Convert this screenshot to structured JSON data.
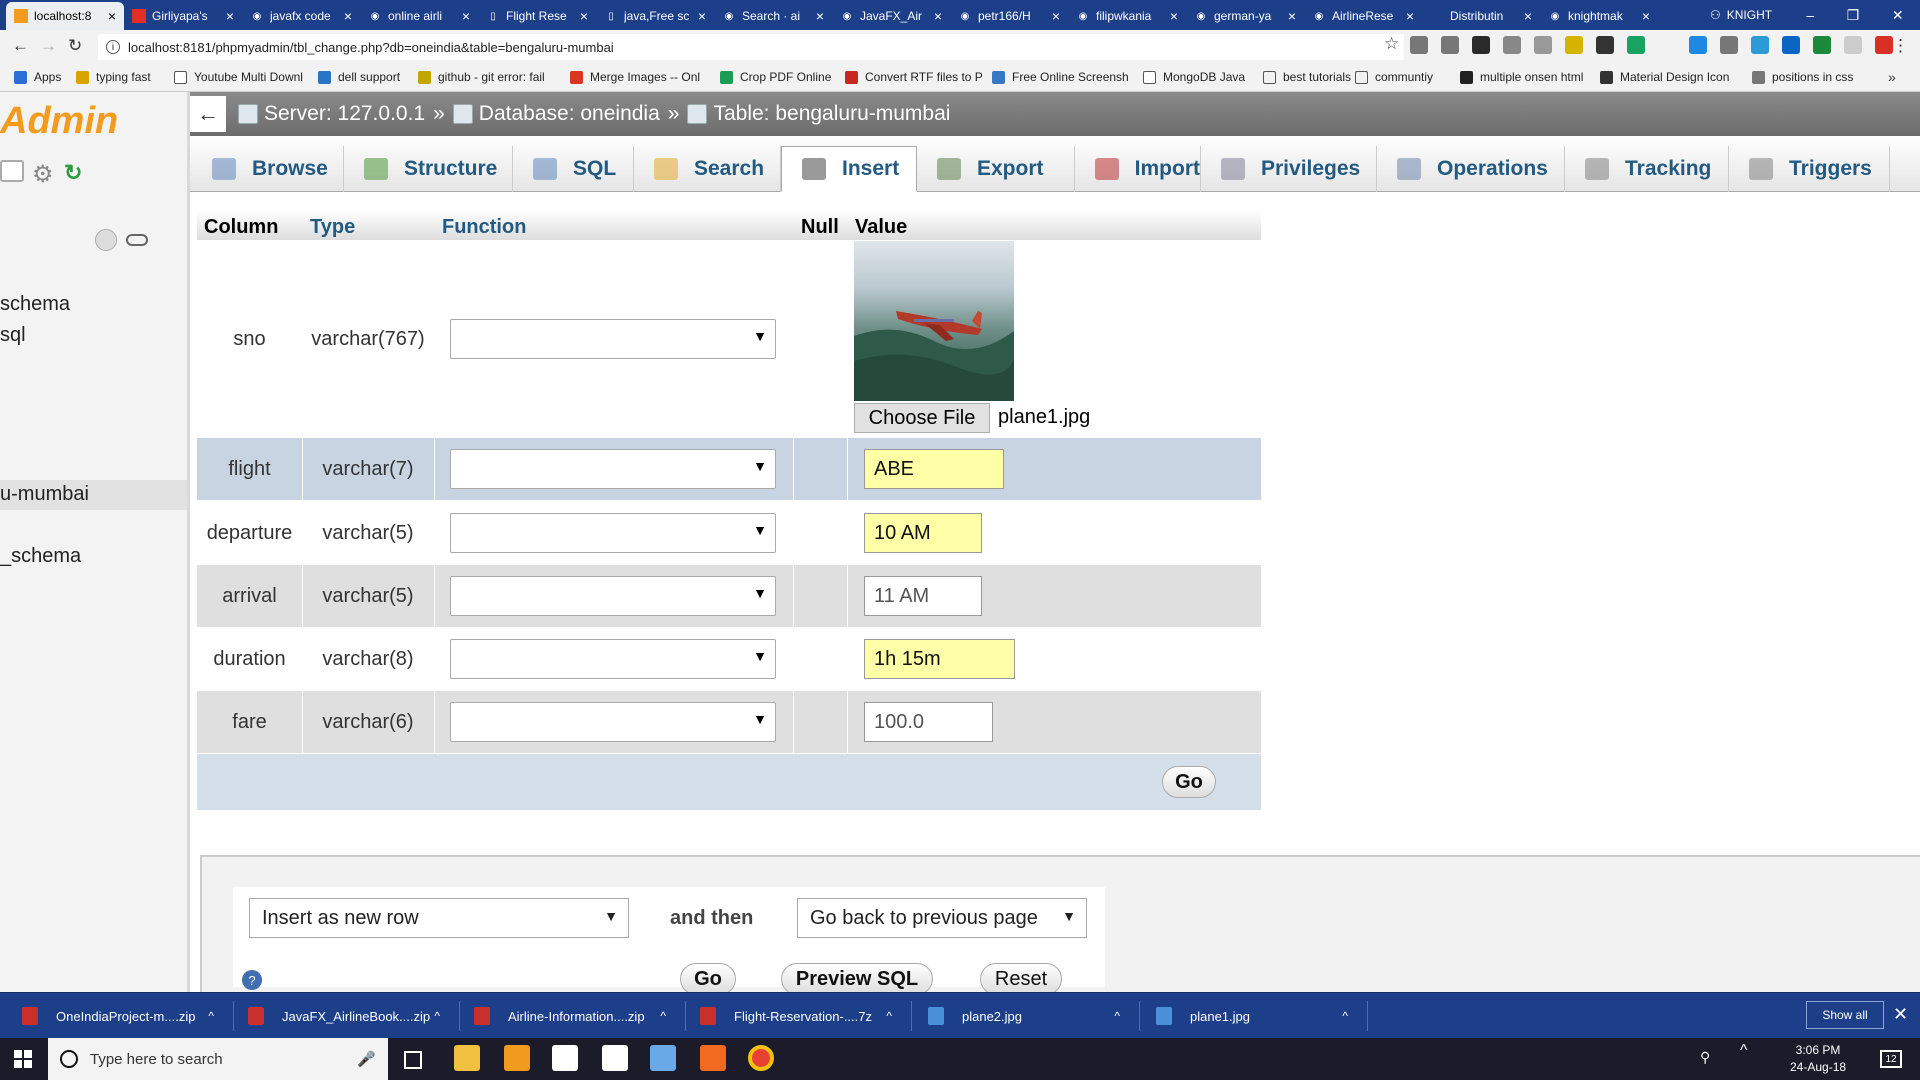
{
  "browser": {
    "tabs": [
      {
        "title": "localhost:8",
        "icon": "pma-icon",
        "active": true
      },
      {
        "title": "Girliyapa's",
        "icon": "youtube-icon"
      },
      {
        "title": "javafx code",
        "icon": "globe-icon"
      },
      {
        "title": "online airli",
        "icon": "globe-icon"
      },
      {
        "title": "Flight Rese",
        "icon": "page-icon"
      },
      {
        "title": "java,Free sc",
        "icon": "page-icon"
      },
      {
        "title": "Search · ai",
        "icon": "github-icon"
      },
      {
        "title": "JavaFX_Air",
        "icon": "github-icon"
      },
      {
        "title": "petr166/H",
        "icon": "github-icon"
      },
      {
        "title": "filipwkania",
        "icon": "github-icon"
      },
      {
        "title": "german-ya",
        "icon": "github-icon"
      },
      {
        "title": "AirlineRese",
        "icon": "github-icon"
      },
      {
        "title": "Distributin",
        "icon": "colorful-icon"
      },
      {
        "title": "knightmak",
        "icon": "github-icon"
      }
    ],
    "profile_name": "KNIGHT",
    "url": "localhost:8181/phpmyadmin/tbl_change.php?db=oneindia&table=bengaluru-mumbai",
    "bookmarks": [
      {
        "label": "Apps",
        "color": "#2b6fd6"
      },
      {
        "label": "typing fast",
        "color": "#d9a400"
      },
      {
        "label": "Youtube Multi Downl",
        "color": "#ffffff"
      },
      {
        "label": "dell support",
        "color": "#2a74c5"
      },
      {
        "label": "github - git error: fail",
        "color": "#c4a500"
      },
      {
        "label": "Merge Images -- Onl",
        "color": "#d9381e"
      },
      {
        "label": "Crop PDF Online",
        "color": "#1c9c55"
      },
      {
        "label": "Convert RTF files to P",
        "color": "#c7271e"
      },
      {
        "label": "Free Online Screensh",
        "color": "#3a77c2"
      },
      {
        "label": "MongoDB Java",
        "color": "#ffffff"
      },
      {
        "label": "best tutorials",
        "color": "#f2f2f2"
      },
      {
        "label": "communtiy",
        "color": "#f2f2f2"
      },
      {
        "label": "multiple onsen html",
        "color": "#222222"
      },
      {
        "label": "Material Design Icon",
        "color": "#333333"
      },
      {
        "label": "positions in css",
        "color": "#777777"
      }
    ]
  },
  "sidebar": {
    "logo_text": "Admin",
    "items": [
      "schema",
      "sql",
      "u-mumbai",
      "_schema"
    ]
  },
  "breadcrumb": {
    "server": "Server: 127.0.0.1",
    "sep1": "»",
    "database": "Database: oneindia",
    "sep2": "»",
    "table": "Table: bengaluru-mumbai"
  },
  "menu_tabs": [
    "Browse",
    "Structure",
    "SQL",
    "Search",
    "Insert",
    "Export",
    "Import",
    "Privileges",
    "Operations",
    "Tracking",
    "Triggers"
  ],
  "active_tab": "Insert",
  "insert_table": {
    "headers": {
      "column": "Column",
      "type": "Type",
      "function": "Function",
      "null": "Null",
      "value": "Value"
    },
    "rows": [
      {
        "column": "sno",
        "type": "varchar(767)",
        "value": "",
        "file_name": "plane1.jpg",
        "choose_label": "Choose File"
      },
      {
        "column": "flight",
        "type": "varchar(7)",
        "value": "ABE"
      },
      {
        "column": "departure",
        "type": "varchar(5)",
        "value": "10 AM"
      },
      {
        "column": "arrival",
        "type": "varchar(5)",
        "value": "11 AM"
      },
      {
        "column": "duration",
        "type": "varchar(8)",
        "value": "1h 15m"
      },
      {
        "column": "fare",
        "type": "varchar(6)",
        "value": "100.0"
      }
    ],
    "go_label": "Go"
  },
  "bottom_form": {
    "insert_mode": "Insert as new row",
    "and_then": "and then",
    "after_action": "Go back to previous page",
    "go_label": "Go",
    "preview_label": "Preview SQL",
    "reset_label": "Reset"
  },
  "downloads": [
    {
      "name": "OneIndiaProject-m....zip",
      "type": "zip"
    },
    {
      "name": "JavaFX_AirlineBook....zip",
      "type": "zip"
    },
    {
      "name": "Airline-Information....zip",
      "type": "zip"
    },
    {
      "name": "Flight-Reservation-....7z",
      "type": "zip"
    },
    {
      "name": "plane2.jpg",
      "type": "img"
    },
    {
      "name": "plane1.jpg",
      "type": "img"
    }
  ],
  "downloads_show_all": "Show all",
  "taskbar": {
    "search_placeholder": "Type here to search",
    "time": "3:06 PM",
    "date": "24-Aug-18",
    "notif_count": "12"
  }
}
